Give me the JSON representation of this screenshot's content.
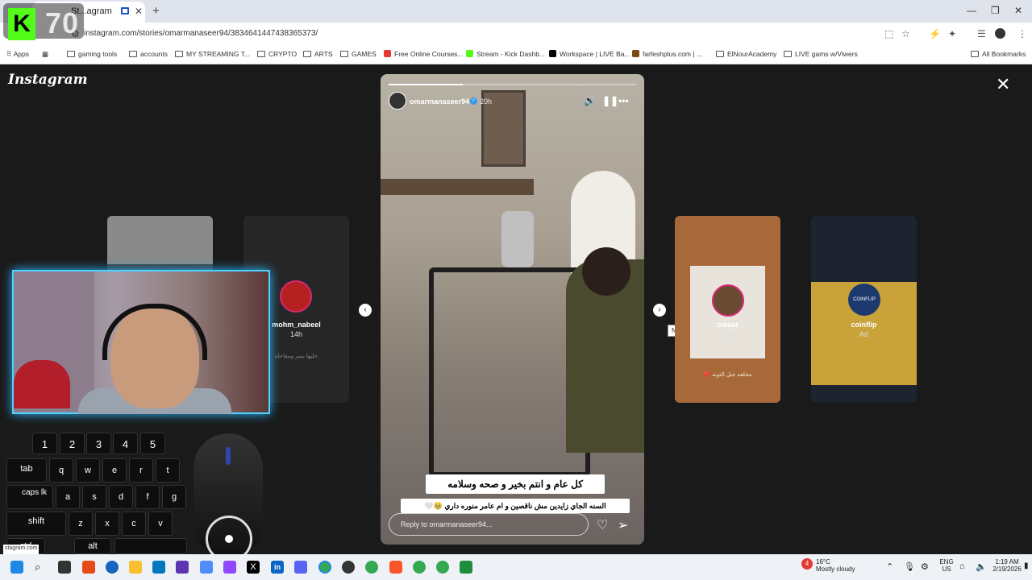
{
  "browser": {
    "tab_title": "St...agram",
    "url": "instagram.com/stories/omarmanaseer94/3834641447438365373/",
    "new_tab_symbol": "+",
    "close_tab_symbol": "✕",
    "window_controls": [
      "—",
      "❐",
      "✕"
    ],
    "bookmarks": [
      {
        "label": "Apps",
        "icon": "apps-grid-icon"
      },
      {
        "label": "",
        "icon": "apps-launcher-icon"
      },
      {
        "label": "gaming tools",
        "icon": "folder-icon"
      },
      {
        "label": "accounts",
        "icon": "folder-icon"
      },
      {
        "label": "MY STREAMING T...",
        "icon": "folder-icon"
      },
      {
        "label": "CRYPTO",
        "icon": "folder-icon"
      },
      {
        "label": "ARTS",
        "icon": "folder-icon"
      },
      {
        "label": "GAMES",
        "icon": "folder-icon"
      },
      {
        "label": "Free Online Courses...",
        "icon": "site-icon"
      },
      {
        "label": "Stream - Kick Dashb...",
        "icon": "kick-icon"
      },
      {
        "label": "Workspace | LIVE Ba...",
        "icon": "tiktok-icon"
      },
      {
        "label": "farfeshplus.com | ...",
        "icon": "site-icon"
      },
      {
        "label": "ElNourAcademy",
        "icon": "folder-icon"
      },
      {
        "label": "LIVE gams w/Viwers",
        "icon": "folder-icon"
      }
    ],
    "all_bookmarks": "All Bookmarks"
  },
  "overlay": {
    "kick_letter": "K",
    "kick_count": "70"
  },
  "instagram": {
    "logo": "Instagram",
    "close_symbol": "✕",
    "story": {
      "username": "omarmanaseer94",
      "verified_mark": "✓",
      "time": "20h",
      "progress": 0.3,
      "caption_main": "كل عام و انتم بخير و صحه وسلامه",
      "caption_sub": "السنه الجاي زايدين مش ناقصين و ام عامر منوره داري 🥹🤍",
      "reply_placeholder": "Reply to omarmanaseer94..."
    },
    "prev_symbol": "‹",
    "next_symbol": "›",
    "next_tooltip": "Next",
    "side_stories": [
      {
        "username": "mohm_nabeel",
        "time": "14h",
        "caption": "حليها بسر ومفاجاه"
      },
      {
        "username": "omaar",
        "time": "19h",
        "caption": "مخلفه جبل التوبه 💔"
      },
      {
        "username": "coinflip",
        "time": "Ad",
        "brand": "COINFLIP"
      }
    ]
  },
  "keyboard_overlay": {
    "number_keys": [
      "1",
      "2",
      "3",
      "4",
      "5"
    ],
    "row1": [
      "tab",
      "q",
      "w",
      "e",
      "r",
      "t"
    ],
    "row2": [
      "caps lk",
      "a",
      "s",
      "d",
      "f",
      "g"
    ],
    "row3": [
      "shift",
      "z",
      "x",
      "c",
      "v"
    ],
    "row4": [
      "ctrl",
      "alt"
    ]
  },
  "taskbar": {
    "weather_temp": "16°C",
    "weather_text": "Mostly cloudy",
    "weather_badge": "4",
    "lang_line1": "ENG",
    "lang_line2": "US",
    "time": "1:19 AM",
    "date": "2/19/2026",
    "hidden_window_url": "stagram.com"
  },
  "colors": {
    "kick_green": "#53fc18",
    "webcam_glow": "#4fd1ff",
    "instagram_ring": "#d62976",
    "verified_blue": "#3897f0"
  }
}
